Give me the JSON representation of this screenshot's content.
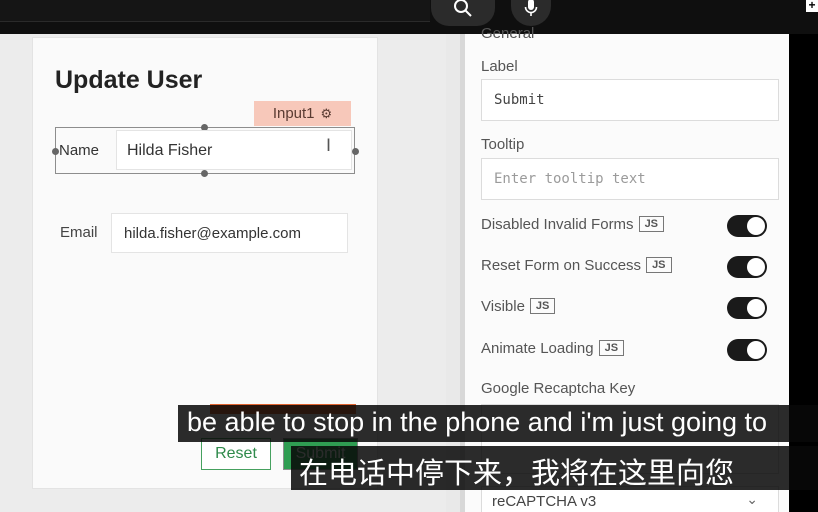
{
  "topbar": {
    "search_icon": "search-icon",
    "mic_icon": "microphone-icon",
    "corner": "+"
  },
  "form": {
    "title": "Update User",
    "selected_widget_tag": "Input1",
    "name_label": "Name",
    "name_value": "Hilda Fisher",
    "email_label": "Email",
    "email_value": "hilda.fisher@example.com",
    "reset_label": "Reset",
    "submit_label": "Submit"
  },
  "pane": {
    "section_heading": "General",
    "label_title": "Label",
    "label_value": "Submit",
    "tooltip_title": "Tooltip",
    "tooltip_placeholder": "Enter tooltip text",
    "toggles": [
      {
        "label": "Disabled Invalid Forms",
        "badge": "JS",
        "on": true
      },
      {
        "label": "Reset Form on Success",
        "badge": "JS",
        "on": true
      },
      {
        "label": "Visible",
        "badge": "JS",
        "on": true
      },
      {
        "label": "Animate Loading",
        "badge": "JS",
        "on": true
      }
    ],
    "recaptcha_key_label": "Google Recaptcha Key",
    "recaptcha_type_value": "reCAPTCHA v3"
  },
  "subtitles": {
    "english": "be able to stop in the phone and i'm just going to",
    "chinese": "在电话中停下来，我将在这里向您"
  },
  "colors": {
    "accent_green": "#2f9d52",
    "tag_salmon": "#f7c8ba",
    "toggle_on": "#1a1a1a"
  }
}
